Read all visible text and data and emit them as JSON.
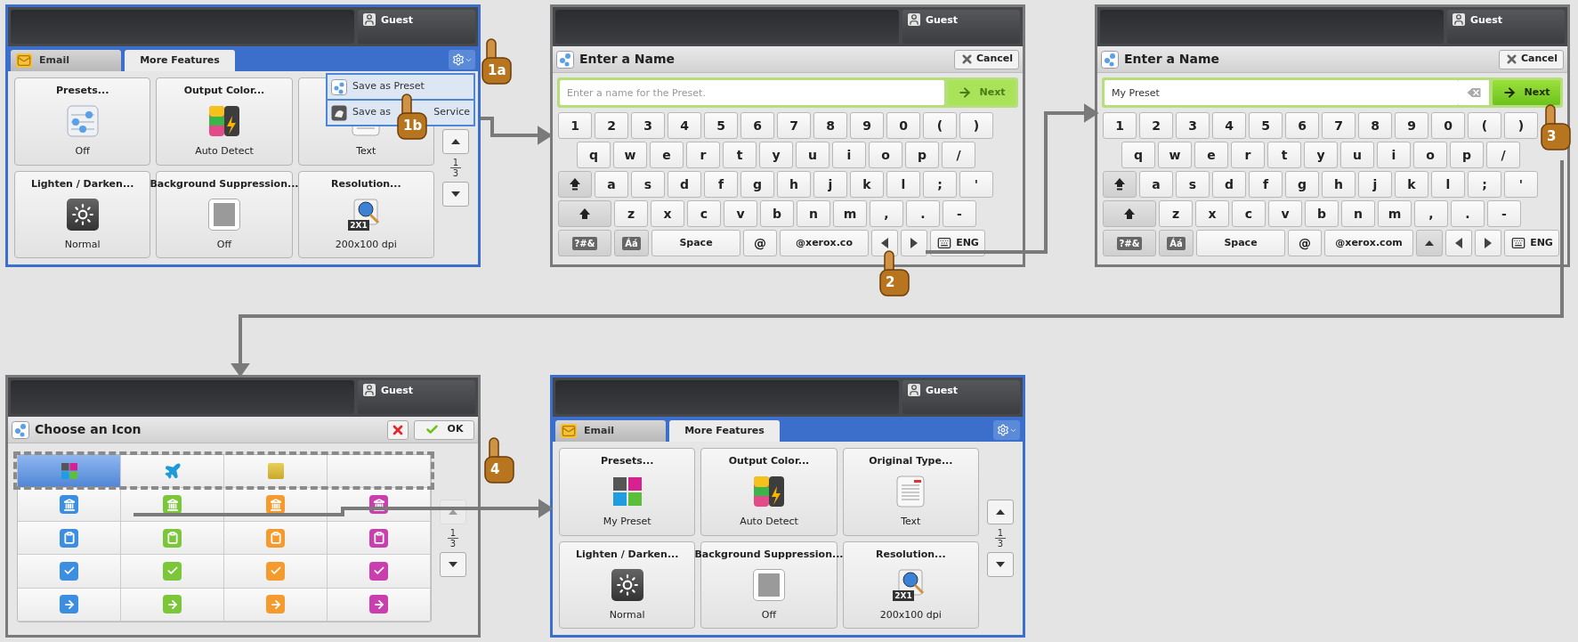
{
  "screens": [
    {
      "kind": "features",
      "user": "Guest",
      "tabs": [
        {
          "kind": "email",
          "label": "Email",
          "selected": false
        },
        {
          "kind": "plain",
          "label": "More Features",
          "selected": true
        }
      ],
      "menu": {
        "items": [
          {
            "kind": "preset",
            "label": "Save as Preset"
          },
          {
            "kind": "service",
            "label": "Save as",
            "label_end": "Service"
          }
        ]
      },
      "tiles": [
        {
          "kind": "presets",
          "title": "Presets...",
          "value": "Off"
        },
        {
          "kind": "color",
          "title": "Output Color...",
          "value": "Auto Detect"
        },
        {
          "kind": "original_type",
          "value": "Text"
        },
        {
          "kind": "lighten",
          "title": "Lighten / Darken...",
          "value": "Normal"
        },
        {
          "kind": "background",
          "title": "Background Suppression...",
          "value": "Off"
        },
        {
          "kind": "resolution",
          "title": "Resolution...",
          "value": "200x100 dpi",
          "icon_text": "2X1"
        }
      ],
      "page": {
        "current": "1",
        "total": "3",
        "up_disabled": false
      },
      "steps": [
        "1a",
        "1b"
      ]
    },
    {
      "kind": "keyboard",
      "user": "Guest",
      "title": "Enter a Name",
      "cancel": "Cancel",
      "field": {
        "placeholder": "Enter a name for the Preset."
      },
      "next": {
        "label": "Next",
        "disabled": true
      },
      "keys": [
        [
          "1",
          "2",
          "3",
          "4",
          "5",
          "6",
          "7",
          "8",
          "9",
          "0",
          "(",
          ")"
        ],
        [
          "q",
          "w",
          "e",
          "r",
          "t",
          "y",
          "u",
          "i",
          "o",
          "p",
          "/"
        ],
        [
          {
            "kind": "caps"
          },
          "a",
          "s",
          "d",
          "f",
          "g",
          "h",
          "j",
          "k",
          "l",
          ";",
          "'"
        ],
        [
          {
            "kind": "shift"
          },
          "z",
          "x",
          "c",
          "v",
          "b",
          "n",
          "m",
          ",",
          ".",
          "-"
        ],
        [
          {
            "kind": "symbols",
            "label": "?#&"
          },
          {
            "kind": "accents",
            "label": "Áá"
          },
          {
            "kind": "space",
            "label": "Space"
          },
          "@",
          {
            "kind": "domain",
            "label": "@xerox.co"
          },
          {
            "kind": "left"
          },
          {
            "kind": "right"
          },
          {
            "kind": "lang",
            "label": "ENG"
          }
        ]
      ],
      "steps": [
        "2"
      ]
    },
    {
      "kind": "keyboard",
      "user": "Guest",
      "title": "Enter a Name",
      "cancel": "Cancel",
      "field": {
        "value": "My Preset"
      },
      "next": {
        "label": "Next",
        "disabled": false
      },
      "keys": [
        [
          "1",
          "2",
          "3",
          "4",
          "5",
          "6",
          "7",
          "8",
          "9",
          "0",
          "(",
          ")"
        ],
        [
          "q",
          "w",
          "e",
          "r",
          "t",
          "y",
          "u",
          "i",
          "o",
          "p",
          "/"
        ],
        [
          {
            "kind": "caps"
          },
          "a",
          "s",
          "d",
          "f",
          "g",
          "h",
          "j",
          "k",
          "l",
          ";",
          "'"
        ],
        [
          {
            "kind": "shift"
          },
          "z",
          "x",
          "c",
          "v",
          "b",
          "n",
          "m",
          ",",
          ".",
          "-"
        ],
        [
          {
            "kind": "symbols",
            "label": "?#&"
          },
          {
            "kind": "accents",
            "label": "Áá"
          },
          {
            "kind": "space",
            "label": "Space"
          },
          "@",
          {
            "kind": "domain",
            "label": "@xerox.com"
          },
          {
            "kind": "up"
          },
          {
            "kind": "left"
          },
          {
            "kind": "right"
          },
          {
            "kind": "lang",
            "label": "ENG"
          }
        ]
      ],
      "steps": [
        "3"
      ]
    },
    {
      "kind": "icon_picker",
      "user": "Guest",
      "title": "Choose an Icon",
      "ok": "OK",
      "rows": [
        [
          {
            "kind": "palette",
            "selected": true
          },
          {
            "kind": "plane",
            "selected": false
          },
          {
            "kind": "box",
            "selected": false
          },
          {
            "kind": "empty",
            "selected": false
          }
        ],
        [
          {
            "kind": "bank",
            "color": "#3b8ee0",
            "selected": false
          },
          {
            "kind": "bank",
            "color": "#7cc63a",
            "selected": false
          },
          {
            "kind": "bank",
            "color": "#f59a2c",
            "selected": false
          },
          {
            "kind": "bank",
            "color": "#c93fae",
            "selected": false
          }
        ],
        [
          {
            "kind": "clipboard",
            "color": "#3b8ee0",
            "selected": false
          },
          {
            "kind": "clipboard",
            "color": "#7cc63a",
            "selected": false
          },
          {
            "kind": "clipboard",
            "color": "#f59a2c",
            "selected": false
          },
          {
            "kind": "clipboard",
            "color": "#c93fae",
            "selected": false
          }
        ],
        [
          {
            "kind": "check",
            "color": "#3b8ee0",
            "selected": false
          },
          {
            "kind": "check",
            "color": "#7cc63a",
            "selected": false
          },
          {
            "kind": "check",
            "color": "#f59a2c",
            "selected": false
          },
          {
            "kind": "check",
            "color": "#c93fae",
            "selected": false
          }
        ],
        [
          {
            "kind": "arrow",
            "color": "#3b8ee0",
            "selected": false
          },
          {
            "kind": "arrow",
            "color": "#7cc63a",
            "selected": false
          },
          {
            "kind": "arrow",
            "color": "#f59a2c",
            "selected": false
          },
          {
            "kind": "arrow",
            "color": "#c93fae",
            "selected": false
          }
        ]
      ],
      "page": {
        "current": "1",
        "total": "3",
        "up_disabled": true
      },
      "steps": [
        "4"
      ]
    },
    {
      "kind": "features",
      "user": "Guest",
      "tabs": [
        {
          "kind": "email",
          "label": "Email",
          "selected": false
        },
        {
          "kind": "plain",
          "label": "More Features",
          "selected": true
        }
      ],
      "tiles": [
        {
          "kind": "custom_preset",
          "title": "Presets...",
          "value": "My Preset"
        },
        {
          "kind": "color",
          "title": "Output Color...",
          "value": "Auto Detect"
        },
        {
          "kind": "original_type",
          "title": "Original Type...",
          "value": "Text"
        },
        {
          "kind": "lighten",
          "title": "Lighten / Darken...",
          "value": "Normal"
        },
        {
          "kind": "background",
          "title": "Background Suppression...",
          "value": "Off"
        },
        {
          "kind": "resolution",
          "title": "Resolution...",
          "value": "200x100 dpi",
          "icon_text": "2X1"
        }
      ],
      "page": {
        "current": "1",
        "total": "3",
        "up_disabled": false
      }
    }
  ]
}
